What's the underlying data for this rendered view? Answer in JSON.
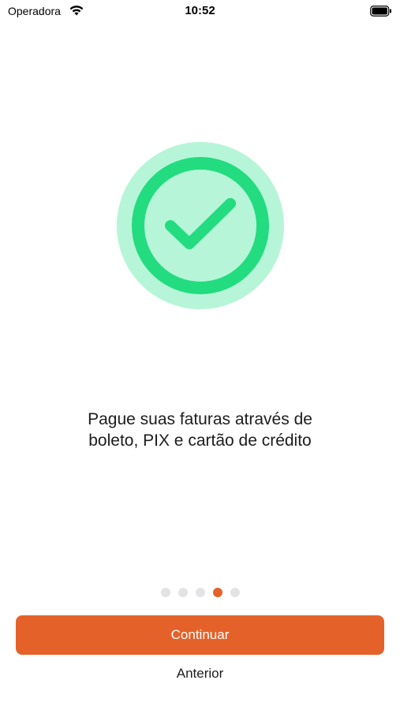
{
  "status_bar": {
    "carrier": "Operadora",
    "time": "10:52",
    "wifi_icon": "wifi-icon",
    "battery_icon": "battery-icon"
  },
  "illustration": {
    "icon": "checkmark-circle-icon",
    "colors": {
      "halo": "#b6f5d8",
      "ring": "#22dc7f",
      "check": "#22dc7f"
    }
  },
  "onboarding": {
    "message_line1": "Pague suas faturas através de",
    "message_line2": "boleto, PIX e cartão de crédito"
  },
  "pager": {
    "count": 5,
    "active_index": 3,
    "active_color": "#e4622a"
  },
  "actions": {
    "continue_label": "Continuar",
    "previous_label": "Anterior"
  },
  "colors": {
    "accent": "#e4622a"
  }
}
